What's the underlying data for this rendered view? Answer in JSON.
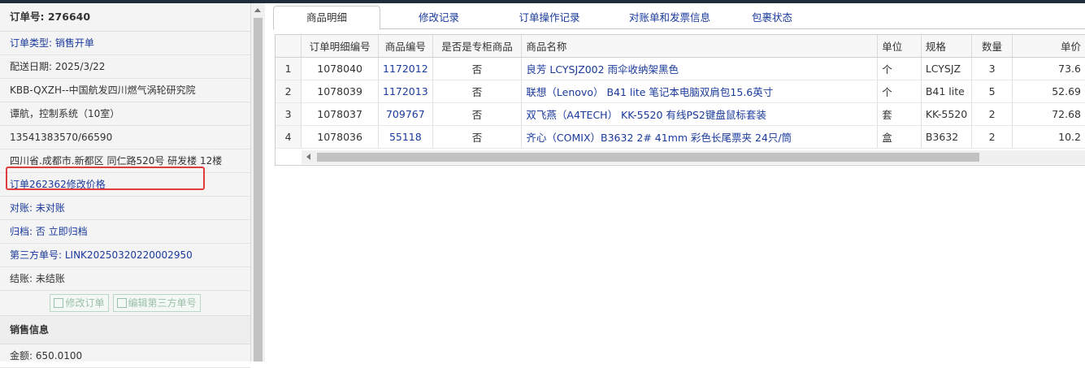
{
  "left_panel": {
    "order_title": "订单号: 276640",
    "rows": [
      {
        "text": "订单类型: 销售开单",
        "color": "blue"
      },
      {
        "text": "配送日期: 2025/3/22",
        "color": "dark"
      },
      {
        "text": "KBB-QXZH--中国航发四川燃气涡轮研究院",
        "color": "dark"
      },
      {
        "text": "谭航，控制系统（10室）",
        "color": "dark"
      },
      {
        "text": "13541383570/66590",
        "color": "dark"
      },
      {
        "text": "四川省.成都市.新都区 同仁路520号 研发楼 12楼",
        "color": "dark"
      },
      {
        "text": "订单262362修改价格",
        "color": "blue"
      },
      {
        "text": "对账: 未对账",
        "color": "blue"
      },
      {
        "text": "归档: 否 立即归档",
        "color": "blue"
      },
      {
        "text": "第三方单号: LINK20250320220002950",
        "color": "blue"
      },
      {
        "text": "结账: 未结账",
        "color": "dark"
      }
    ],
    "buttons": {
      "edit_order": "修改订单",
      "edit_third_party": "编辑第三方单号"
    },
    "sales_section": "销售信息",
    "amount": "金额: 650.0100"
  },
  "tabs": [
    {
      "label": "商品明细",
      "active": true
    },
    {
      "label": "修改记录",
      "active": false
    },
    {
      "label": "订单操作记录",
      "active": false
    },
    {
      "label": "对账单和发票信息",
      "active": false
    },
    {
      "label": "包裹状态",
      "active": false
    }
  ],
  "table": {
    "headers": [
      "订单明细编号",
      "商品编号",
      "是否是专柜商品",
      "商品名称",
      "单位",
      "规格",
      "数量",
      "单价"
    ],
    "rows": [
      [
        "1",
        "1078040",
        "1172012",
        "否",
        "良芳 LCYSJZ002 雨伞收纳架黑色",
        "个",
        "LCYSJZ",
        "3",
        "73.6"
      ],
      [
        "2",
        "1078039",
        "1172013",
        "否",
        "联想（Lenovo） B41 lite 笔记本电脑双肩包15.6英寸",
        "个",
        "B41 lite",
        "5",
        "52.69"
      ],
      [
        "3",
        "1078037",
        "709767",
        "否",
        "双飞燕（A4TECH） KK-5520 有线PS2键盘鼠标套装",
        "套",
        "KK-5520",
        "2",
        "72.68"
      ],
      [
        "4",
        "1078036",
        "55118",
        "否",
        "齐心（COMIX）B3632 2# 41mm 彩色长尾票夹 24只/筒",
        "盒",
        "B3632",
        "2",
        "10.2"
      ]
    ]
  },
  "colors": {
    "link": "#1a3a9c",
    "highlight_border": "#e03c3c",
    "topbar": "#1f2d3d"
  }
}
